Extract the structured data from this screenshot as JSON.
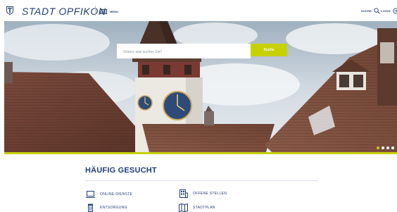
{
  "header": {
    "brand": "STADT OPFIKON",
    "menu_label": "MENU",
    "search_label": "SUCHE",
    "login_label": "LOGIN"
  },
  "hero": {
    "search_placeholder": "Grüezi, was suchen Sie?",
    "search_button": "Suche",
    "slide_count": 4,
    "active_slide": 1
  },
  "popular": {
    "title": "HÄUFIG GESUCHT",
    "items": [
      {
        "label": "ONLINE-DIENSTE",
        "icon": "laptop-icon"
      },
      {
        "label": "OFFENE STELLEN",
        "icon": "building-icon"
      },
      {
        "label": "ENTSORGUNG",
        "icon": "trash-icon"
      },
      {
        "label": "STADTPLAN",
        "icon": "map-icon"
      }
    ]
  },
  "colors": {
    "brand_blue": "#1f3c78",
    "accent_lime": "#c7d100"
  }
}
